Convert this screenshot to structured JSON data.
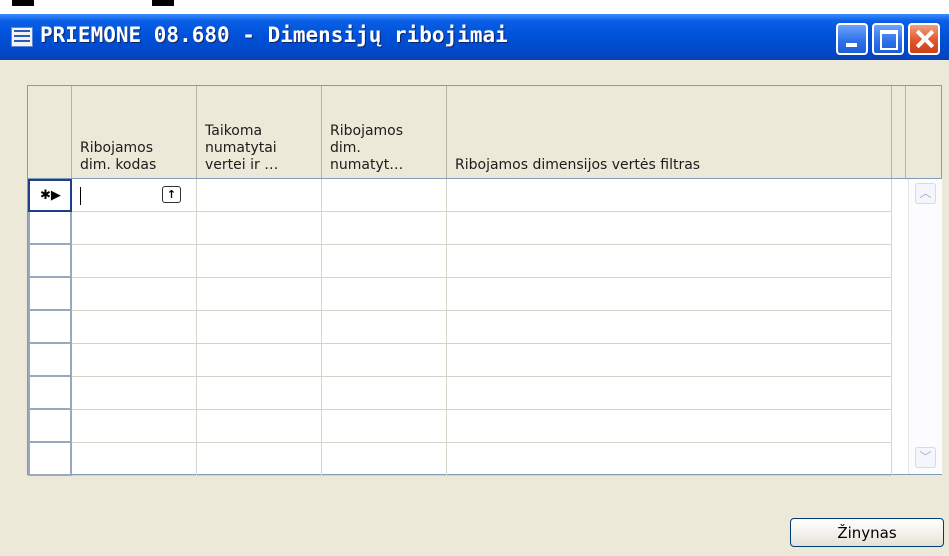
{
  "window": {
    "title": "PRIEMONE 08.680 - Dimensijų ribojimai",
    "icon": "table-window-icon",
    "controls": [
      "minimize",
      "maximize",
      "close"
    ]
  },
  "grid": {
    "columns": [
      {
        "label": "Ribojamos\ndim. kodas"
      },
      {
        "label": "Taikoma\nnumatytai\nvertei ir …"
      },
      {
        "label": "Ribojamos\ndim.\nnumatyt…"
      },
      {
        "label": "Ribojamos dimensijos vertės filtras"
      }
    ],
    "new_row_marker": "✱▶",
    "rows_visible": 9,
    "lookup_icon": "up-arrow-lookup-icon"
  },
  "buttons": {
    "help": "Žinynas"
  },
  "colors": {
    "titlebar": "#0052d9",
    "window_bg": "#ece9d8",
    "grid_border": "#7f9db9",
    "close_button": "#e0562d"
  }
}
